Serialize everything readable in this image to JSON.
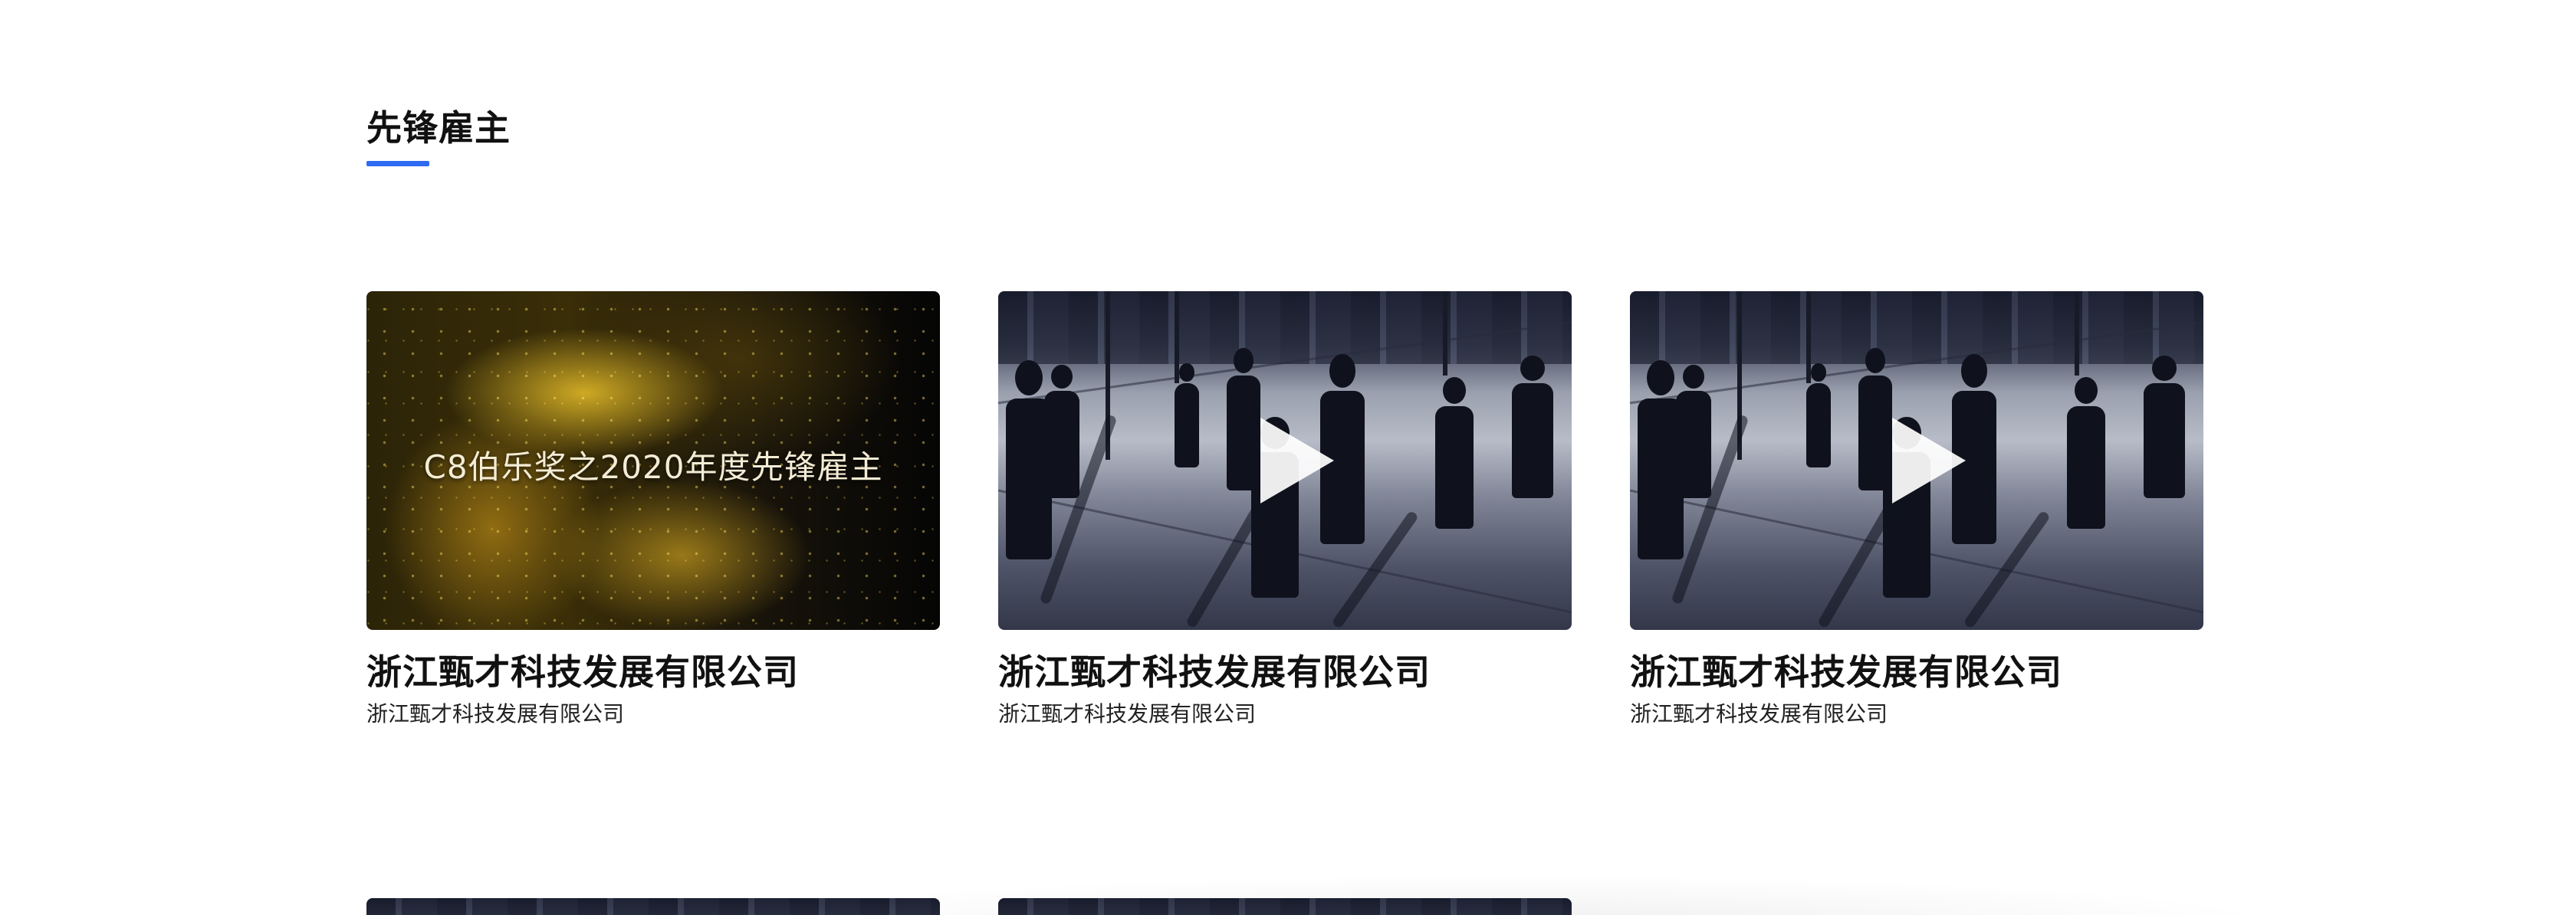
{
  "section": {
    "title": "先锋雇主",
    "accent_color": "#2f6bf2"
  },
  "cards": [
    {
      "thumbnail_type": "award-gold",
      "thumbnail_caption": "C8伯乐奖之2020年度先锋雇主",
      "title": "浙江甄才科技发展有限公司",
      "subtitle": "浙江甄才科技发展有限公司"
    },
    {
      "thumbnail_type": "city-walkers-video",
      "play_icon": "play-icon",
      "title": "浙江甄才科技发展有限公司",
      "subtitle": "浙江甄才科技发展有限公司"
    },
    {
      "thumbnail_type": "city-walkers-video",
      "play_icon": "play-icon",
      "title": "浙江甄才科技发展有限公司",
      "subtitle": "浙江甄才科技发展有限公司"
    }
  ],
  "next_row": {
    "visible_thumbnails": 2
  }
}
